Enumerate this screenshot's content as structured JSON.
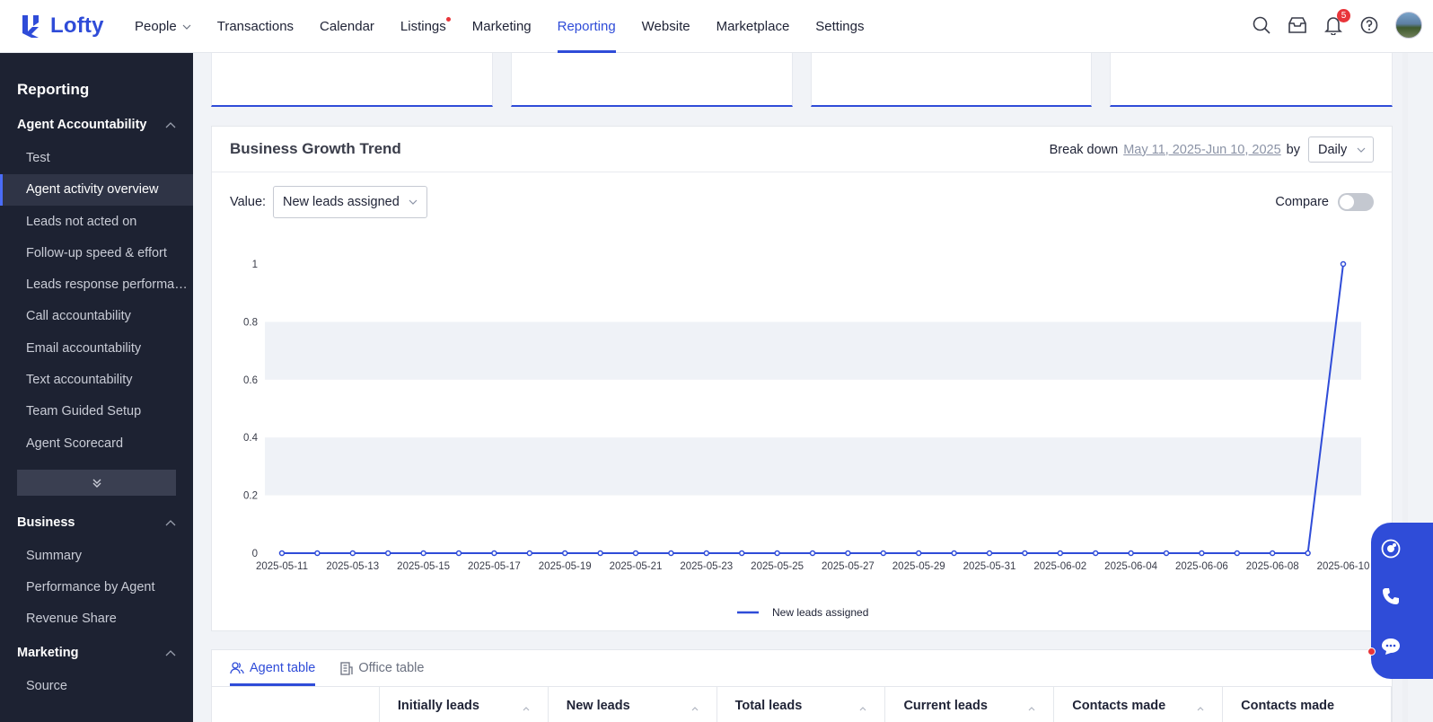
{
  "app": {
    "logo_text": "Lofty",
    "brand_color": "#2f4cd8"
  },
  "nav": {
    "items": [
      {
        "label": "People",
        "has_caret": true
      },
      {
        "label": "Transactions"
      },
      {
        "label": "Calendar"
      },
      {
        "label": "Listings",
        "has_dot": true
      },
      {
        "label": "Marketing"
      },
      {
        "label": "Reporting",
        "active": true
      },
      {
        "label": "Website"
      },
      {
        "label": "Marketplace"
      },
      {
        "label": "Settings"
      }
    ],
    "notification_count": "5",
    "icons": [
      "search-icon",
      "inbox-icon",
      "bell-icon",
      "help-icon",
      "avatar"
    ]
  },
  "sidebar": {
    "title": "Reporting",
    "sections": [
      {
        "label": "Agent Accountability",
        "items": [
          "Test",
          "Agent activity overview",
          "Leads not acted on",
          "Follow-up speed & effort",
          "Leads response performance",
          "Call accountability",
          "Email accountability",
          "Text accountability",
          "Team Guided Setup",
          "Agent Scorecard"
        ],
        "active_index": 1
      },
      {
        "label": "Business",
        "items": [
          "Summary",
          "Performance by Agent",
          "Revenue Share"
        ]
      },
      {
        "label": "Marketing",
        "items": [
          "Source"
        ]
      }
    ]
  },
  "panel": {
    "title": "Business Growth Trend",
    "breakdown_label": "Break down",
    "date_range": "May 11, 2025-Jun 10, 2025",
    "by_label": "by",
    "granularity": "Daily",
    "value_label": "Value:",
    "value_selected": "New leads assigned",
    "compare_label": "Compare",
    "compare_on": false
  },
  "chart_data": {
    "type": "line",
    "title": "",
    "xlabel": "",
    "ylabel": "",
    "ylim": [
      0,
      1
    ],
    "yticks": [
      "0",
      "0.2",
      "0.4",
      "0.6",
      "0.8",
      "1"
    ],
    "x_tick_labels": [
      "2025-05-11",
      "2025-05-13",
      "2025-05-15",
      "2025-05-17",
      "2025-05-19",
      "2025-05-21",
      "2025-05-23",
      "2025-05-25",
      "2025-05-27",
      "2025-05-29",
      "2025-05-31",
      "2025-06-02",
      "2025-06-04",
      "2025-06-06",
      "2025-06-08",
      "2025-06-10"
    ],
    "x": [
      "2025-05-11",
      "2025-05-12",
      "2025-05-13",
      "2025-05-14",
      "2025-05-15",
      "2025-05-16",
      "2025-05-17",
      "2025-05-18",
      "2025-05-19",
      "2025-05-20",
      "2025-05-21",
      "2025-05-22",
      "2025-05-23",
      "2025-05-24",
      "2025-05-25",
      "2025-05-26",
      "2025-05-27",
      "2025-05-28",
      "2025-05-29",
      "2025-05-30",
      "2025-05-31",
      "2025-06-01",
      "2025-06-02",
      "2025-06-03",
      "2025-06-04",
      "2025-06-05",
      "2025-06-06",
      "2025-06-07",
      "2025-06-08",
      "2025-06-09",
      "2025-06-10"
    ],
    "series": [
      {
        "name": "New leads assigned",
        "color": "#2f4cd8",
        "values": [
          0,
          0,
          0,
          0,
          0,
          0,
          0,
          0,
          0,
          0,
          0,
          0,
          0,
          0,
          0,
          0,
          0,
          0,
          0,
          0,
          0,
          0,
          0,
          0,
          0,
          0,
          0,
          0,
          0,
          0,
          1
        ]
      }
    ],
    "legend_position": "bottom-center",
    "grid": "alternating bands"
  },
  "table": {
    "tabs": [
      {
        "label": "Agent table",
        "active": true
      },
      {
        "label": "Office table"
      }
    ],
    "columns": [
      "",
      "Initially leads",
      "New leads",
      "Total leads",
      "Current leads",
      "Contacts made",
      "Contacts made"
    ]
  }
}
